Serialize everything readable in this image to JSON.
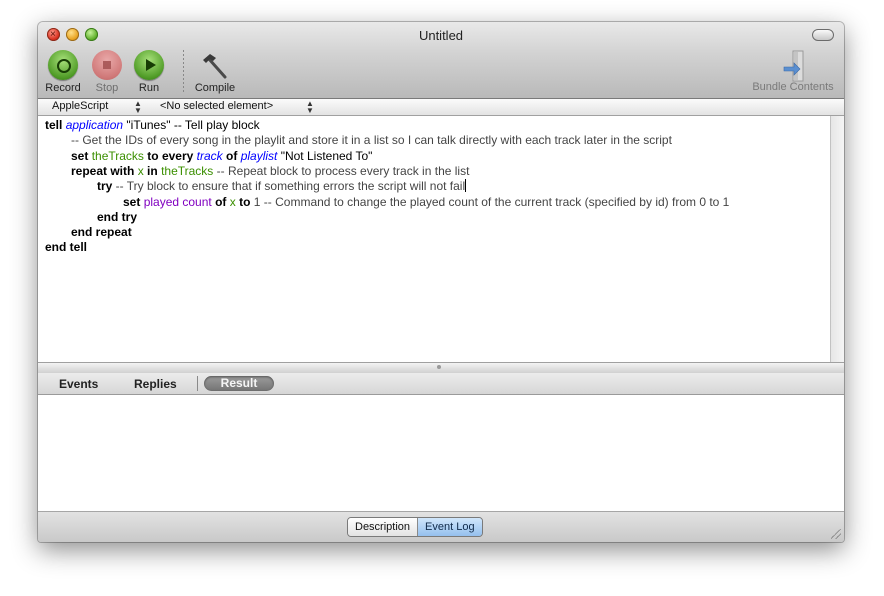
{
  "window": {
    "title": "Untitled"
  },
  "toolbar": {
    "record_label": "Record",
    "stop_label": "Stop",
    "run_label": "Run",
    "compile_label": "Compile",
    "bundle_label": "Bundle Contents"
  },
  "navigation": {
    "language": "AppleScript",
    "element": "<No selected element>"
  },
  "editor": {
    "lines": [
      {
        "indent": 0,
        "tokens": [
          {
            "t": "tell",
            "c": "kw"
          },
          {
            "t": " "
          },
          {
            "t": "application",
            "c": "app"
          },
          {
            "t": " \"iTunes\" -- Tell play block"
          }
        ]
      },
      {
        "indent": 1,
        "tokens": [
          {
            "t": "-- Get the IDs of every song in the playlit and store it in a list so I can talk directly with each track later in the script",
            "c": "cmt"
          }
        ]
      },
      {
        "indent": 1,
        "tokens": [
          {
            "t": "set",
            "c": "kw"
          },
          {
            "t": " "
          },
          {
            "t": "theTracks",
            "c": "var"
          },
          {
            "t": " "
          },
          {
            "t": "to every",
            "c": "kw"
          },
          {
            "t": " "
          },
          {
            "t": "track",
            "c": "app"
          },
          {
            "t": " "
          },
          {
            "t": "of",
            "c": "kw"
          },
          {
            "t": " "
          },
          {
            "t": "playlist",
            "c": "app"
          },
          {
            "t": " \"Not Listened To\""
          }
        ]
      },
      {
        "indent": 1,
        "tokens": [
          {
            "t": "repeat with",
            "c": "kw"
          },
          {
            "t": " "
          },
          {
            "t": "x",
            "c": "var"
          },
          {
            "t": " "
          },
          {
            "t": "in",
            "c": "kw"
          },
          {
            "t": " "
          },
          {
            "t": "theTracks",
            "c": "var"
          },
          {
            "t": " -- Repeat block to process every track in the list",
            "c": "cmt"
          }
        ]
      },
      {
        "indent": 2,
        "tokens": [
          {
            "t": "try",
            "c": "kw"
          },
          {
            "t": " -- Try block to ensure that if something errors the script will not fail",
            "c": "cmt"
          },
          {
            "t": "",
            "c": "caret"
          }
        ]
      },
      {
        "indent": 3,
        "tokens": [
          {
            "t": "set",
            "c": "kw"
          },
          {
            "t": " "
          },
          {
            "t": "played count",
            "c": "prop"
          },
          {
            "t": " "
          },
          {
            "t": "of",
            "c": "kw"
          },
          {
            "t": " "
          },
          {
            "t": "x",
            "c": "var"
          },
          {
            "t": " "
          },
          {
            "t": "to",
            "c": "kw"
          },
          {
            "t": " 1 -- Command to change the played count of the current track (specified by id) from 0 to 1",
            "c": "cmt"
          }
        ]
      },
      {
        "indent": 2,
        "tokens": [
          {
            "t": "end try",
            "c": "kw"
          }
        ]
      },
      {
        "indent": 1,
        "tokens": [
          {
            "t": "end repeat",
            "c": "kw"
          }
        ]
      },
      {
        "indent": 0,
        "tokens": [
          {
            "t": "end tell",
            "c": "kw"
          }
        ]
      }
    ]
  },
  "result_tabs": {
    "events": "Events",
    "replies": "Replies",
    "result": "Result"
  },
  "bottom": {
    "description": "Description",
    "event_log": "Event Log"
  },
  "colors": {
    "keyword": "#000000",
    "application": "#0000ff",
    "variable": "#3b8f00",
    "property": "#8000c0",
    "selected_segment": "#95c0ee"
  }
}
